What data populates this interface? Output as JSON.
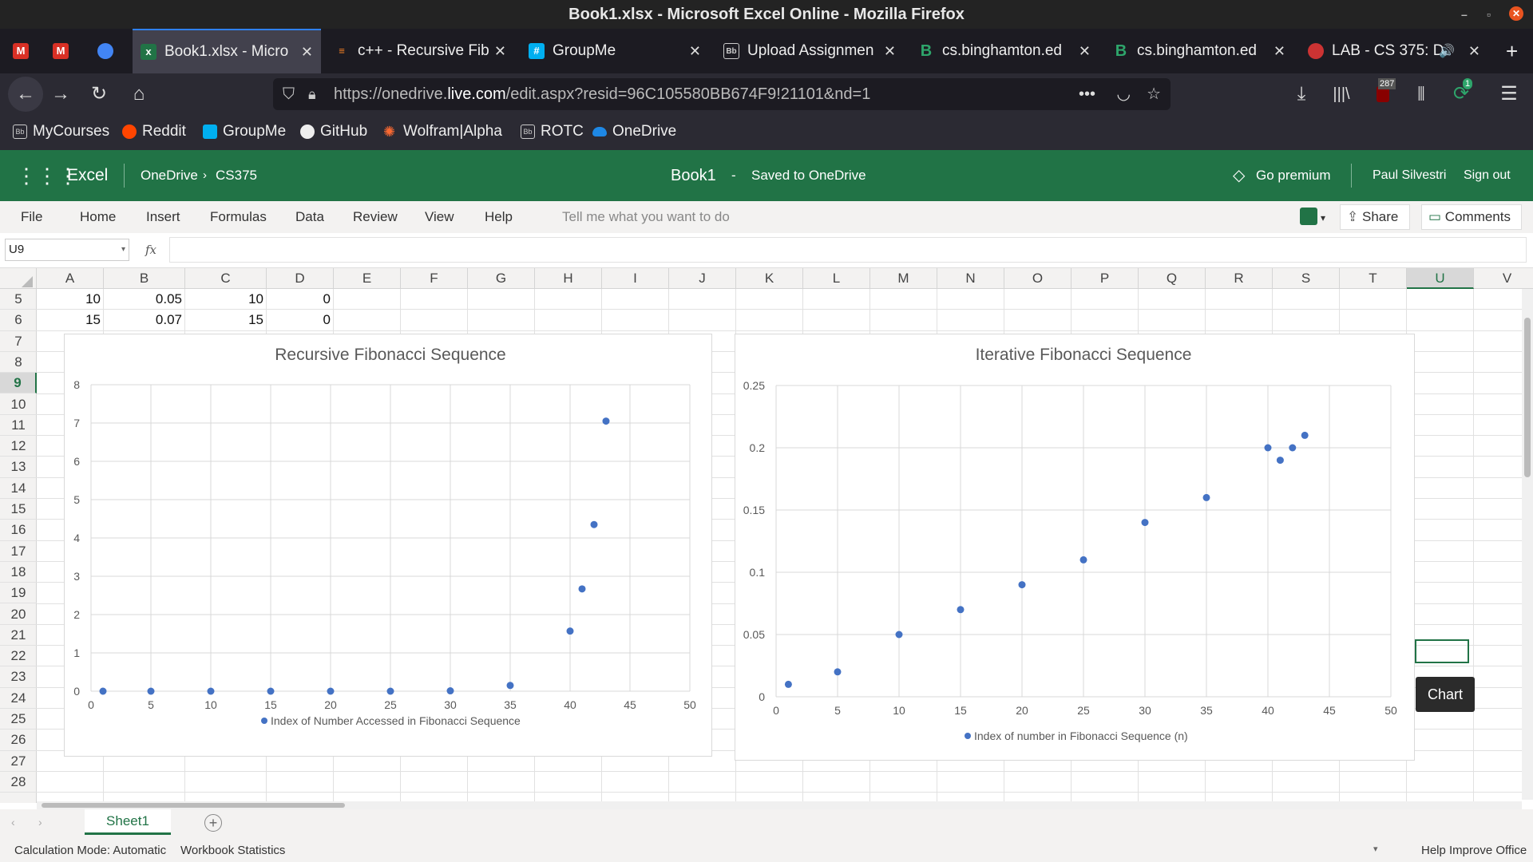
{
  "window_title": "Book1.xlsx - Microsoft Excel Online - Mozilla Firefox",
  "tabs": [
    {
      "label": "",
      "icon": "gmail-icon"
    },
    {
      "label": "",
      "icon": "gmail-icon"
    },
    {
      "label": "",
      "icon": "meet-icon"
    },
    {
      "label": "Book1.xlsx - Micro",
      "icon": "excel-icon"
    },
    {
      "label": "c++ - Recursive Fib",
      "icon": "stackoverflow-icon"
    },
    {
      "label": "GroupMe",
      "icon": "groupme-icon"
    },
    {
      "label": "Upload Assignmen",
      "icon": "blackboard-icon"
    },
    {
      "label": "cs.binghamton.ed",
      "icon": "binghamton-icon"
    },
    {
      "label": "cs.binghamton.ed",
      "icon": "binghamton-icon"
    },
    {
      "label": "LAB - CS 375: D",
      "icon": "lab-icon"
    }
  ],
  "url": {
    "prefix": "https://onedrive.",
    "domain": "live.com",
    "suffix": "/edit.aspx?resid=96C105580BB674F9!21101&nd=1"
  },
  "badges": {
    "ublock": "287",
    "extension": "1"
  },
  "bookmarks": [
    "MyCourses",
    "Reddit",
    "GroupMe",
    "GitHub",
    "Wolfram|Alpha",
    "ROTC",
    "OneDrive"
  ],
  "excel": {
    "app": "Excel",
    "breadcrumb": [
      "OneDrive",
      "CS375"
    ],
    "doc_title": "Book1",
    "separator": "-",
    "save_status": "Saved to OneDrive",
    "premium": "Go premium",
    "user": "Paul Silvestri",
    "signout": "Sign out"
  },
  "ribbon": {
    "tabs": [
      "File",
      "Home",
      "Insert",
      "Formulas",
      "Data",
      "Review",
      "View",
      "Help"
    ],
    "search_placeholder": "Tell me what you want to do",
    "share": "Share",
    "comments": "Comments"
  },
  "formula": {
    "namebox": "U9",
    "fx": "fx",
    "value": ""
  },
  "columns": [
    "A",
    "B",
    "C",
    "D",
    "E",
    "F",
    "G",
    "H",
    "I",
    "J",
    "K",
    "L",
    "M",
    "N",
    "O",
    "P",
    "Q",
    "R",
    "S",
    "T",
    "U",
    "V"
  ],
  "rows": [
    "5",
    "6",
    "7",
    "8",
    "9",
    "10",
    "11",
    "12",
    "13",
    "14",
    "15",
    "16",
    "17",
    "18",
    "19",
    "20",
    "21",
    "22",
    "23",
    "24",
    "25",
    "26",
    "27",
    "28"
  ],
  "cells": {
    "r5": [
      "10",
      "0.05",
      "10",
      "0"
    ],
    "r6": [
      "15",
      "0.07",
      "15",
      "0"
    ]
  },
  "tooltip": "Chart",
  "sheet": {
    "name": "Sheet1",
    "add": "+"
  },
  "status": {
    "calc": "Calculation Mode: Automatic",
    "stats": "Workbook Statistics",
    "help": "Help Improve Office"
  },
  "chart_data": [
    {
      "type": "scatter",
      "title": "Recursive Fibonacci Sequence",
      "series": [
        {
          "name": "Index of Number Accessed in Fibonacci Sequence",
          "x": [
            1,
            5,
            10,
            15,
            20,
            25,
            30,
            35,
            40,
            41,
            42,
            43
          ],
          "y": [
            0,
            0,
            0,
            0,
            0,
            0,
            0.01,
            0.15,
            1.57,
            2.67,
            4.35,
            7.05
          ]
        }
      ],
      "xlim": [
        0,
        50
      ],
      "ylim": [
        0,
        8
      ],
      "xticks": [
        "0",
        "5",
        "10",
        "15",
        "20",
        "25",
        "30",
        "35",
        "40",
        "45",
        "50"
      ],
      "yticks": [
        "0",
        "1",
        "2",
        "3",
        "4",
        "5",
        "6",
        "7",
        "8"
      ],
      "grid": true,
      "legend": "bottom",
      "color": "#4472c4"
    },
    {
      "type": "scatter",
      "title": "Iterative Fibonacci Sequence",
      "series": [
        {
          "name": "Index of number in Fibonacci Sequence (n)",
          "x": [
            1,
            5,
            10,
            15,
            20,
            25,
            30,
            35,
            40,
            41,
            42,
            43
          ],
          "y": [
            0.01,
            0.02,
            0.05,
            0.07,
            0.09,
            0.11,
            0.14,
            0.16,
            0.2,
            0.19,
            0.2,
            0.21
          ]
        }
      ],
      "xlim": [
        0,
        50
      ],
      "ylim": [
        0,
        0.25
      ],
      "xticks": [
        "0",
        "5",
        "10",
        "15",
        "20",
        "25",
        "30",
        "35",
        "40",
        "45",
        "50"
      ],
      "yticks": [
        "0",
        "0.05",
        "0.1",
        "0.15",
        "0.2",
        "0.25"
      ],
      "grid": true,
      "legend": "bottom",
      "color": "#4472c4"
    }
  ]
}
